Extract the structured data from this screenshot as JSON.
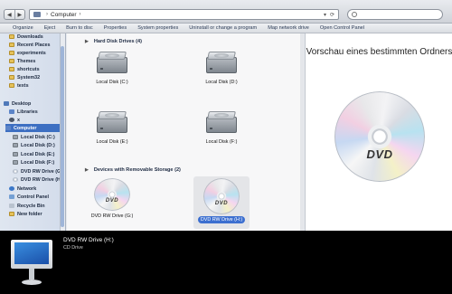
{
  "address": {
    "crumbs": [
      "Computer"
    ],
    "separator": "›"
  },
  "search": {
    "placeholder": ""
  },
  "toolbar": {
    "items": [
      "Organize",
      "Eject",
      "Burn to disc",
      "Properties",
      "System properties",
      "Uninstall or change a program",
      "Map network drive",
      "Open Control Panel"
    ]
  },
  "sidebar": {
    "items": [
      {
        "label": "Downloads",
        "icon": "folder-icon"
      },
      {
        "label": "Recent Places",
        "icon": "folder-icon"
      },
      {
        "label": "experiments",
        "icon": "folder-icon"
      },
      {
        "label": "Themes",
        "icon": "folder-icon"
      },
      {
        "label": "shortcuts",
        "icon": "folder-icon"
      },
      {
        "label": "System32",
        "icon": "folder-icon"
      },
      {
        "label": "texts",
        "icon": "folder-icon"
      },
      {
        "label": "Desktop",
        "icon": "desktop-icon"
      },
      {
        "label": "Libraries",
        "icon": "libraries-icon"
      },
      {
        "label": "x",
        "icon": "user-icon"
      },
      {
        "label": "Computer",
        "icon": "computer-icon"
      },
      {
        "label": "Local Disk (C:)",
        "icon": "disk-icon"
      },
      {
        "label": "Local Disk (D:)",
        "icon": "disk-icon"
      },
      {
        "label": "Local Disk (E:)",
        "icon": "disk-icon"
      },
      {
        "label": "Local Disk (F:)",
        "icon": "disk-icon"
      },
      {
        "label": "DVD RW Drive (G:)",
        "icon": "dvd-icon"
      },
      {
        "label": "DVD RW Drive (H:)",
        "icon": "dvd-icon"
      },
      {
        "label": "Network",
        "icon": "network-icon"
      },
      {
        "label": "Control Panel",
        "icon": "control-panel-icon"
      },
      {
        "label": "Recycle Bin",
        "icon": "recycle-bin-icon"
      },
      {
        "label": "New folder",
        "icon": "folder-icon"
      }
    ],
    "selected": "Computer"
  },
  "main": {
    "groups": [
      {
        "title": "Hard Disk Drives (4)"
      },
      {
        "title": "Devices with Removable Storage (2)"
      }
    ],
    "hard_disks": [
      {
        "label": "Local Disk (C:)"
      },
      {
        "label": "Local Disk (D:)"
      },
      {
        "label": "Local Disk (E:)"
      },
      {
        "label": "Local Disk (F:)"
      }
    ],
    "removable": [
      {
        "label": "DVD RW Drive (G:)",
        "logo": "DVD"
      },
      {
        "label": "DVD RW Drive (H:)",
        "logo": "DVD",
        "selected": true
      }
    ]
  },
  "preview": {
    "title": "Vorschau eines bestimmten Ordners",
    "logo": "DVD"
  },
  "details": {
    "name": "DVD RW Drive (H:)",
    "type": "CD Drive"
  },
  "colors": {
    "selection": "#3c6fd0",
    "sidebar_selection": "#3d6fc2",
    "details_bg": "#000000"
  }
}
